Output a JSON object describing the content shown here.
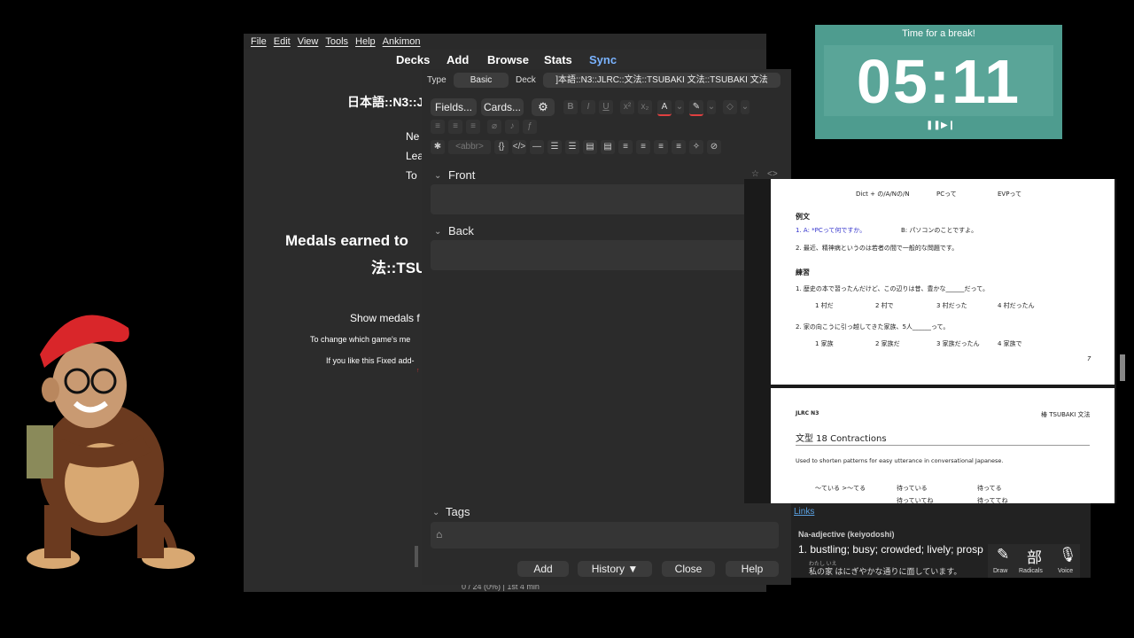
{
  "anki": {
    "menu": [
      "File",
      "Edit",
      "View",
      "Tools",
      "Help",
      "Ankimon"
    ],
    "toolbar": {
      "decks": "Decks",
      "add": "Add",
      "browse": "Browse",
      "stats": "Stats",
      "sync": "Sync"
    },
    "deck_title": "日本語::N3::J",
    "stats": {
      "new": "Ne",
      "learning": "Lea",
      "to_review": "To"
    },
    "medals_line1": "Medals earned to",
    "medals_line2": "法::TSU",
    "show_medals": "Show medals f",
    "change_game": "To change which game's me",
    "fixed_addon": "If you like this Fixed add-",
    "footer_status": "0 / 24 (0%) | 1st 4 min"
  },
  "add_window": {
    "type_label": "Type",
    "type_value": "Basic",
    "deck_label": "Deck",
    "deck_value": "]本語::N3::JLRC::文法::TSUBAKI 文法::TSUBAKI 文法",
    "fields_button": "Fields...",
    "cards_button": "Cards...",
    "abbr_label": "<abbr>",
    "front_label": "Front",
    "back_label": "Back",
    "tags_label": "Tags",
    "add_button": "Add",
    "history_button": "History ▼",
    "close_button": "Close",
    "help_button": "Help"
  },
  "timer": {
    "title": "Time for a break!",
    "time": "05:11",
    "bg_color": "#4e9c8f"
  },
  "pdf": {
    "page1": {
      "header": [
        "Dict + の/A/Nの/N",
        "PCって",
        "EVPって"
      ],
      "example_heading": "例文",
      "ex1": "1. A: *PCって何ですか。",
      "ex1b": "B: パソコンのことですよ。",
      "ex2": "2. 最近、精神病というのは若者の間で一般的な問題です。",
      "practice_heading": "練習",
      "q1": "1. 歴史の本で習ったんだけど、この辺りは昔、豊かな______だって。",
      "q1_opts": [
        "1 村だ",
        "2 村で",
        "3 村だった",
        "4 村だったん"
      ],
      "q2": "2. 家の向こうに引っ越してきた家族、5人______って。",
      "q2_opts": [
        "1 家族",
        "2 家族だ",
        "3 家族だったん",
        "4 家族で"
      ],
      "page_num": "7"
    },
    "page2": {
      "left_header": "JLRC N3",
      "right_header": "椿 TSUBAKI 文法",
      "pattern_title": "文型 18  Contractions",
      "desc": "Used to shorten patterns for easy utterance in conversational Japanese.",
      "row1": [
        "～ている >～てる",
        "待っている",
        "待ってる"
      ],
      "row2": [
        "",
        "待っていてね",
        "待っててね"
      ]
    }
  },
  "dictionary": {
    "links": "Links",
    "pos": "Na-adjective (keiyodoshi)",
    "meaning": "1.  bustling; busy; crowded; lively; prosp",
    "example": "私の家 はにぎやかな通りに面しています。",
    "furigana": "わたし いえ",
    "draw_label": "Draw",
    "radicals_label": "Radicals",
    "voice_label": "Voice",
    "radicals_glyph": "部"
  }
}
